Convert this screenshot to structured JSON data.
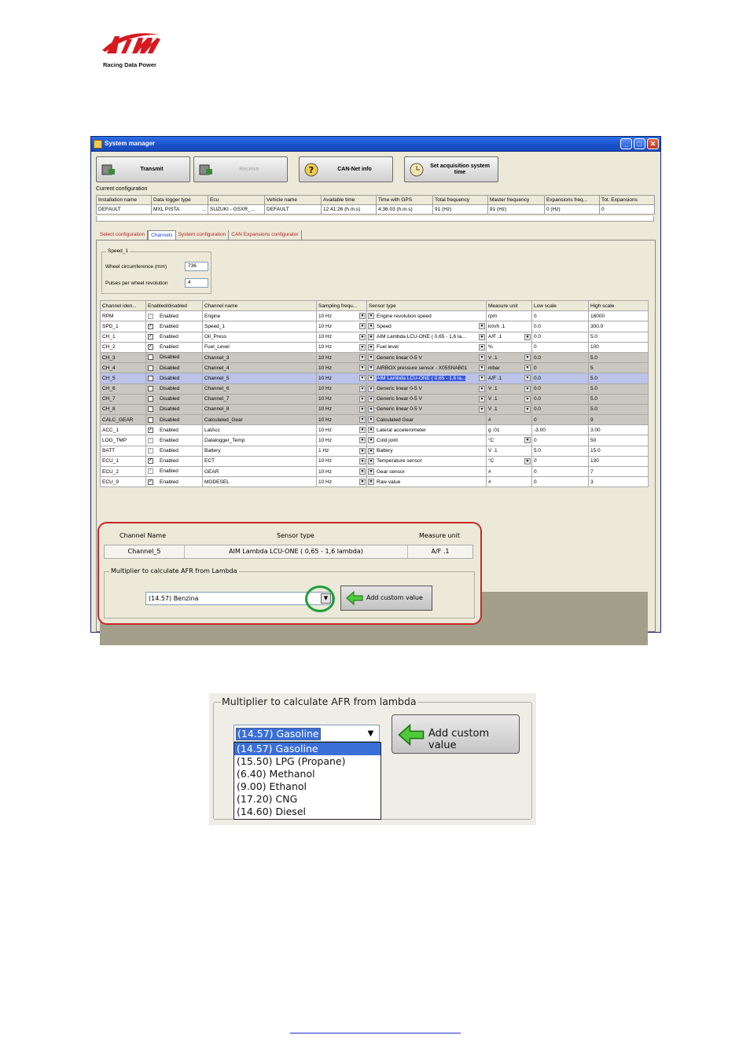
{
  "logo": {
    "tagline": "Racing Data Power"
  },
  "window": {
    "title": "System manager",
    "toolbar": {
      "transmit": "Transmit",
      "receive": "Receive",
      "can_net": "CAN-Net info",
      "set_time": "Set acquisition system time"
    },
    "current_config_label": "Current configuration",
    "config": {
      "headers": [
        "Installation name",
        "Data logger type",
        "Ecu",
        "Vehicle name",
        "Available time",
        "Time with GPS",
        "Total frequency",
        "Master frequency",
        "Expansions freq...",
        "Tot. Expansions"
      ],
      "row": [
        "DEFAULT",
        "MXL PISTA",
        "SUZUKI - GSXR_...",
        "DEFAULT",
        "12:41:26 (h.m.s)",
        "4:36:03 (h.m.s)",
        "91 (Hz)",
        "91 (Hz)",
        "0 (Hz)",
        "0"
      ],
      "ellipsis": "..."
    },
    "tabs": [
      "Select configuration",
      "Channels",
      "System configuration",
      "CAN Expansions configurator"
    ],
    "speed": {
      "group": "Speed_1",
      "wheel_label": "Wheel circumference    (mm)",
      "wheel_value": "736",
      "pulses_label": "Pulses per wheel revolution",
      "pulses_value": "4"
    },
    "grid": {
      "headers": [
        "Channel iden...",
        "Enabled/disabled",
        "Channel name",
        "Sampling frequ...",
        "Sensor type",
        "Measure unit",
        "Low scale",
        "High scale"
      ],
      "rows": [
        {
          "id": "RPM",
          "state": "Enabled",
          "check": "grey",
          "name": "Engine",
          "freq": "10 Hz",
          "sensor": "Engine revolution speed",
          "sdd": false,
          "unit": "rpm",
          "udd": false,
          "low": "0",
          "high": "16000",
          "style": ""
        },
        {
          "id": "SPD_1",
          "state": "Enabled",
          "check": "on",
          "name": "Speed_1",
          "freq": "10 Hz",
          "sensor": "Speed",
          "sdd": true,
          "unit": "km/h  .1",
          "udd": false,
          "low": "0.0",
          "high": "300.0",
          "style": ""
        },
        {
          "id": "CH_1",
          "state": "Enabled",
          "check": "on",
          "name": "Oil_Press",
          "freq": "10 Hz",
          "sensor": "AIM Lambda LCU-ONE ( 0,65 - 1,6 la...",
          "sdd": true,
          "unit": "A/F  .1",
          "udd": true,
          "low": "0.0",
          "high": "5.0",
          "style": ""
        },
        {
          "id": "CH_2",
          "state": "Enabled",
          "check": "on",
          "name": "Fuel_Level",
          "freq": "10 Hz",
          "sensor": "Fuel level",
          "sdd": true,
          "unit": "%",
          "udd": false,
          "low": "0",
          "high": "100",
          "style": ""
        },
        {
          "id": "CH_3",
          "state": "Disabled",
          "check": "off",
          "name": "Channel_3",
          "freq": "10 Hz",
          "sensor": "Generic linear 0-5 V",
          "sdd": true,
          "unit": "V  .1",
          "udd": true,
          "low": "0.0",
          "high": "5.0",
          "style": "dis"
        },
        {
          "id": "CH_4",
          "state": "Disabled",
          "check": "off",
          "name": "Channel_4",
          "freq": "10 Hz",
          "sensor": "AIRBOX pressure sensor - X05SNAB01",
          "sdd": true,
          "unit": "mbar",
          "udd": true,
          "low": "0",
          "high": "5",
          "style": "dis"
        },
        {
          "id": "CH_5",
          "state": "Disabled",
          "check": "off",
          "name": "Channel_5",
          "freq": "10 Hz",
          "sensor": "AIM Lambda LCU-ONE ( 0,65 - 1,6 la...",
          "sdd": true,
          "unit": "A/F  .1",
          "udd": true,
          "low": "0.0",
          "high": "5.0",
          "style": "sel"
        },
        {
          "id": "CH_6",
          "state": "Disabled",
          "check": "off",
          "name": "Channel_6",
          "freq": "10 Hz",
          "sensor": "Generic linear 0-5 V",
          "sdd": true,
          "unit": "V  .1",
          "udd": true,
          "low": "0.0",
          "high": "5.0",
          "style": "dis"
        },
        {
          "id": "CH_7",
          "state": "Disabled",
          "check": "off",
          "name": "Channel_7",
          "freq": "10 Hz",
          "sensor": "Generic linear 0-5 V",
          "sdd": true,
          "unit": "V  .1",
          "udd": true,
          "low": "0.0",
          "high": "5.0",
          "style": "dis"
        },
        {
          "id": "CH_8",
          "state": "Disabled",
          "check": "off",
          "name": "Channel_8",
          "freq": "10 Hz",
          "sensor": "Generic linear 0-5 V",
          "sdd": true,
          "unit": "V  .1",
          "udd": true,
          "low": "0.0",
          "high": "5.0",
          "style": "dis"
        },
        {
          "id": "CALC_GEAR",
          "state": "Disabled",
          "check": "off",
          "name": "Calculated_Gear",
          "freq": "10 Hz",
          "sensor": "Calculated Gear",
          "sdd": false,
          "unit": "#",
          "udd": false,
          "low": "0",
          "high": "9",
          "style": "dis"
        },
        {
          "id": "ACC_1",
          "state": "Enabled",
          "check": "on",
          "name": "LatAcc",
          "freq": "10 Hz",
          "sensor": "Lateral accelerometer",
          "sdd": false,
          "unit": "g  .01",
          "udd": false,
          "low": "-3.00",
          "high": "3.00",
          "style": ""
        },
        {
          "id": "LOG_TMP",
          "state": "Enabled",
          "check": "grey",
          "name": "Datalogger_Temp",
          "freq": "10 Hz",
          "sensor": "Cold joint",
          "sdd": false,
          "unit": "°C",
          "udd": true,
          "low": "0",
          "high": "50",
          "style": ""
        },
        {
          "id": "BATT",
          "state": "Enabled",
          "check": "grey",
          "name": "Battery",
          "freq": "1 Hz",
          "sensor": "Battery",
          "sdd": false,
          "unit": "V  .1",
          "udd": false,
          "low": "5.0",
          "high": "15.0",
          "style": ""
        },
        {
          "id": "ECU_1",
          "state": "Enabled",
          "check": "on",
          "name": "ECT",
          "freq": "10 Hz",
          "sensor": "Temperature sensor",
          "sdd": false,
          "unit": "°C",
          "udd": true,
          "low": "0",
          "high": "130",
          "style": ""
        },
        {
          "id": "ECU_2",
          "state": "Enabled",
          "check": "grey",
          "name": "GEAR",
          "freq": "10 Hz",
          "sensor": "Gear sensor",
          "sdd": false,
          "unit": "#",
          "udd": false,
          "low": "0",
          "high": "7",
          "style": ""
        },
        {
          "id": "ECU_9",
          "state": "Enabled",
          "check": "on",
          "name": "MODESEL",
          "freq": "10 Hz",
          "sensor": "Raw value",
          "sdd": false,
          "unit": "#",
          "udd": false,
          "low": "0",
          "high": "3",
          "style": ""
        }
      ]
    },
    "callout": {
      "h_name": "Channel Name",
      "h_sensor": "Sensor type",
      "h_unit": "Measure unit",
      "name": "Channel_5",
      "sensor": "AIM Lambda LCU-ONE ( 0,65 - 1,6 lambda)",
      "unit": "A/F  .1",
      "group": "Multiplier to calculate AFR from Lambda",
      "selected": "(14.57) Benzina",
      "add_button": "Add custom value"
    }
  },
  "detail": {
    "group": "Multiplier to calculate AFR from lambda",
    "selected": "(14.57) Gasoline",
    "options": [
      "(14.57) Gasoline",
      "(15.50) LPG (Propane)",
      "(6.40) Methanol",
      "(9.00) Ethanol",
      "(17.20) CNG",
      "(14.60) Diesel"
    ],
    "add_button": "Add custom value"
  },
  "colors": {
    "accent_red": "#c62828",
    "ring_green": "#1e9e3e",
    "selection_blue": "#3a6fd8"
  }
}
